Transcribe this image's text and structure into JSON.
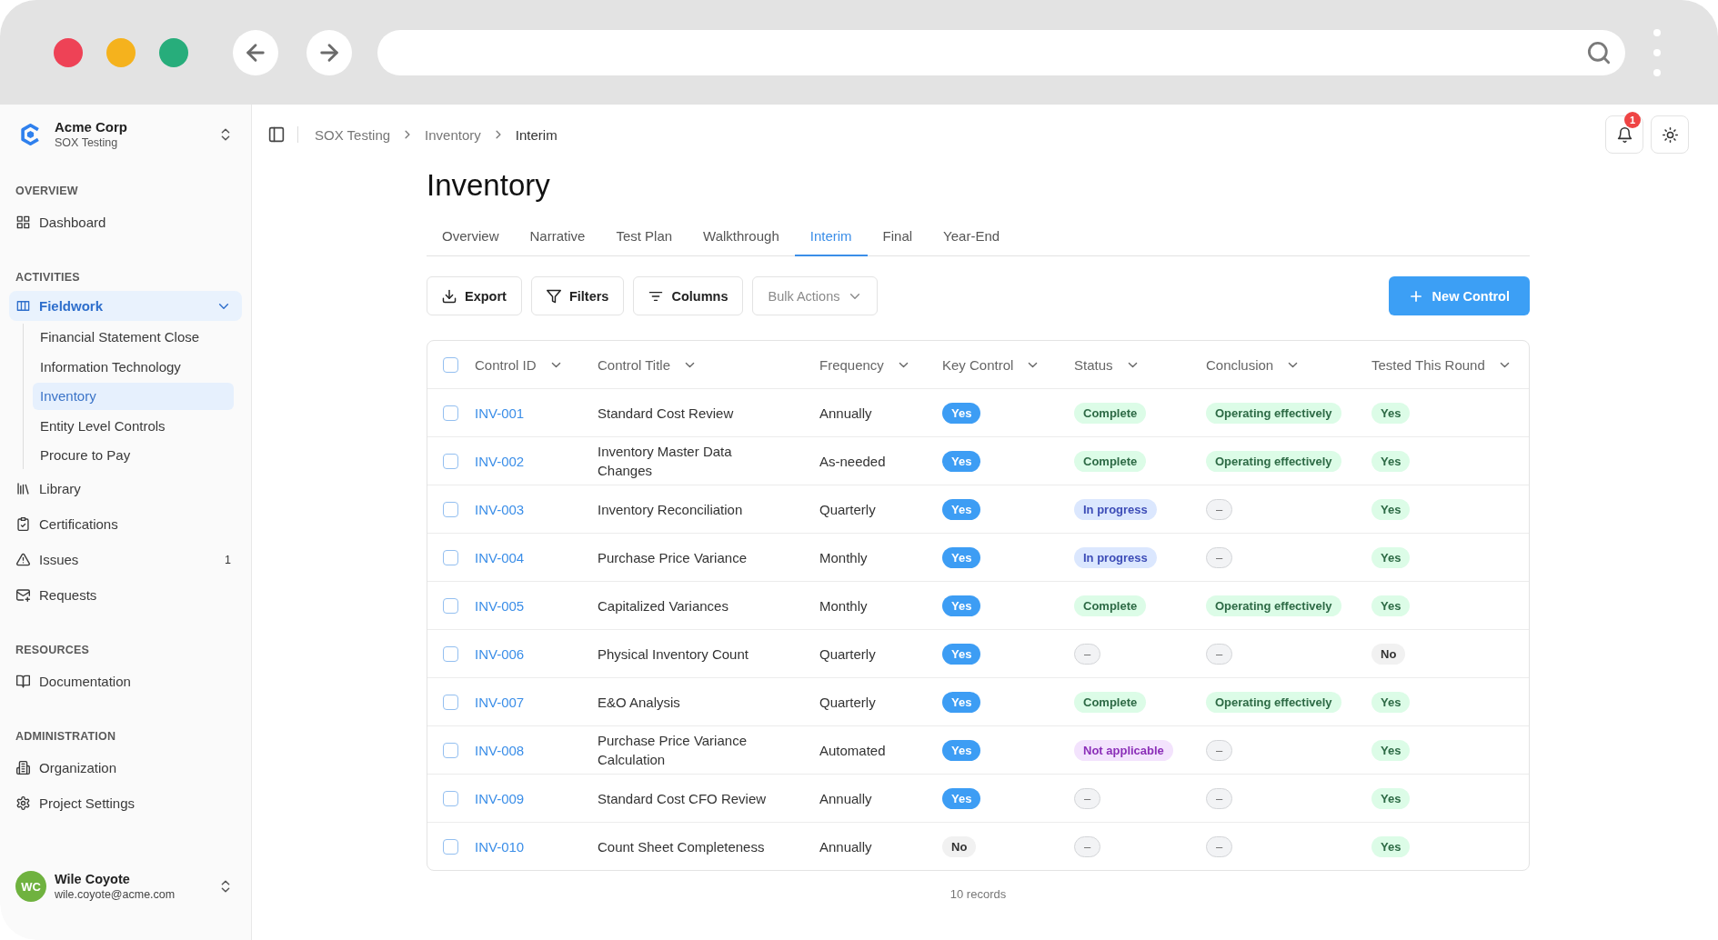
{
  "sidebar": {
    "org": {
      "name": "Acme Corp",
      "subtitle": "SOX Testing"
    },
    "sections": [
      {
        "heading": "OVERVIEW",
        "items": [
          {
            "label": "Dashboard",
            "selected": false
          }
        ]
      },
      {
        "heading": "ACTIVITIES",
        "group": {
          "label": "Fieldwork",
          "selected": true,
          "expanded": true,
          "children": [
            {
              "label": "Financial Statement Close",
              "selected": false
            },
            {
              "label": "Information Technology",
              "selected": false
            },
            {
              "label": "Inventory",
              "selected": true
            },
            {
              "label": "Entity Level Controls",
              "selected": false
            },
            {
              "label": "Procure to Pay",
              "selected": false
            }
          ]
        },
        "items": [
          {
            "label": "Library",
            "selected": false
          },
          {
            "label": "Certifications",
            "selected": false
          },
          {
            "label": "Issues",
            "selected": false,
            "badge": "1"
          },
          {
            "label": "Requests",
            "selected": false
          }
        ]
      },
      {
        "heading": "RESOURCES",
        "items": [
          {
            "label": "Documentation",
            "selected": false
          }
        ]
      },
      {
        "heading": "ADMINISTRATION",
        "items": [
          {
            "label": "Organization",
            "selected": false
          },
          {
            "label": "Project Settings",
            "selected": false
          }
        ]
      }
    ],
    "user": {
      "initials": "WC",
      "name": "Wile Coyote",
      "email": "wile.coyote@acme.com"
    }
  },
  "header": {
    "breadcrumb": [
      "SOX Testing",
      "Inventory",
      "Interim"
    ],
    "notifications": {
      "badge": "1"
    }
  },
  "page": {
    "title": "Inventory",
    "tabs": [
      {
        "label": "Overview",
        "selected": false
      },
      {
        "label": "Narrative",
        "selected": false
      },
      {
        "label": "Test Plan",
        "selected": false
      },
      {
        "label": "Walkthrough",
        "selected": false
      },
      {
        "label": "Interim",
        "selected": true
      },
      {
        "label": "Final",
        "selected": false
      },
      {
        "label": "Year-End",
        "selected": false
      }
    ],
    "toolbar": {
      "buttons": [
        {
          "label": "Export",
          "disabled": false
        },
        {
          "label": "Filters",
          "disabled": false
        },
        {
          "label": "Columns",
          "disabled": false
        },
        {
          "label": "Bulk Actions",
          "disabled": true
        }
      ],
      "primary_button": "New Control"
    },
    "table": {
      "select_all": {
        "checked": false
      },
      "columns": [
        "Control ID",
        "Control Title",
        "Frequency",
        "Key Control",
        "Status",
        "Conclusion",
        "Tested This Round"
      ],
      "rows": [
        {
          "checked": false,
          "id": "INV-001",
          "title": "Standard Cost Review",
          "frequency": "Annually",
          "key_control": {
            "text": "Yes",
            "kind": "primary"
          },
          "status": {
            "text": "Complete",
            "kind": "success"
          },
          "conclusion": {
            "text": "Operating effectively",
            "kind": "success"
          },
          "tested": {
            "text": "Yes",
            "kind": "success"
          }
        },
        {
          "checked": false,
          "id": "INV-002",
          "title": "Inventory Master Data Changes",
          "frequency": "As-needed",
          "key_control": {
            "text": "Yes",
            "kind": "primary"
          },
          "status": {
            "text": "Complete",
            "kind": "success"
          },
          "conclusion": {
            "text": "Operating effectively",
            "kind": "success"
          },
          "tested": {
            "text": "Yes",
            "kind": "success"
          }
        },
        {
          "checked": false,
          "id": "INV-003",
          "title": "Inventory Reconciliation",
          "frequency": "Quarterly",
          "key_control": {
            "text": "Yes",
            "kind": "primary"
          },
          "status": {
            "text": "In progress",
            "kind": "info"
          },
          "conclusion": {
            "text": "–",
            "kind": "empty"
          },
          "tested": {
            "text": "Yes",
            "kind": "success"
          }
        },
        {
          "checked": false,
          "id": "INV-004",
          "title": "Purchase Price Variance",
          "frequency": "Monthly",
          "key_control": {
            "text": "Yes",
            "kind": "primary"
          },
          "status": {
            "text": "In progress",
            "kind": "info"
          },
          "conclusion": {
            "text": "–",
            "kind": "empty"
          },
          "tested": {
            "text": "Yes",
            "kind": "success"
          }
        },
        {
          "checked": false,
          "id": "INV-005",
          "title": "Capitalized Variances",
          "frequency": "Monthly",
          "key_control": {
            "text": "Yes",
            "kind": "primary"
          },
          "status": {
            "text": "Complete",
            "kind": "success"
          },
          "conclusion": {
            "text": "Operating effectively",
            "kind": "success"
          },
          "tested": {
            "text": "Yes",
            "kind": "success"
          }
        },
        {
          "checked": false,
          "id": "INV-006",
          "title": "Physical Inventory Count",
          "frequency": "Quarterly",
          "key_control": {
            "text": "Yes",
            "kind": "primary"
          },
          "status": {
            "text": "–",
            "kind": "empty"
          },
          "conclusion": {
            "text": "–",
            "kind": "empty"
          },
          "tested": {
            "text": "No",
            "kind": "neutral"
          }
        },
        {
          "checked": false,
          "id": "INV-007",
          "title": "E&O Analysis",
          "frequency": "Quarterly",
          "key_control": {
            "text": "Yes",
            "kind": "primary"
          },
          "status": {
            "text": "Complete",
            "kind": "success"
          },
          "conclusion": {
            "text": "Operating effectively",
            "kind": "success"
          },
          "tested": {
            "text": "Yes",
            "kind": "success"
          }
        },
        {
          "checked": false,
          "id": "INV-008",
          "title": "Purchase Price Variance Calculation",
          "frequency": "Automated",
          "key_control": {
            "text": "Yes",
            "kind": "primary"
          },
          "status": {
            "text": "Not applicable",
            "kind": "excluded"
          },
          "conclusion": {
            "text": "–",
            "kind": "empty"
          },
          "tested": {
            "text": "Yes",
            "kind": "success"
          }
        },
        {
          "checked": false,
          "id": "INV-009",
          "title": "Standard Cost CFO Review",
          "frequency": "Annually",
          "key_control": {
            "text": "Yes",
            "kind": "primary"
          },
          "status": {
            "text": "–",
            "kind": "empty"
          },
          "conclusion": {
            "text": "–",
            "kind": "empty"
          },
          "tested": {
            "text": "Yes",
            "kind": "success"
          }
        },
        {
          "checked": false,
          "id": "INV-010",
          "title": "Count Sheet Completeness",
          "frequency": "Annually",
          "key_control": {
            "text": "No",
            "kind": "neutral"
          },
          "status": {
            "text": "–",
            "kind": "empty"
          },
          "conclusion": {
            "text": "–",
            "kind": "empty"
          },
          "tested": {
            "text": "Yes",
            "kind": "success"
          }
        }
      ]
    },
    "footer": "10 records"
  }
}
